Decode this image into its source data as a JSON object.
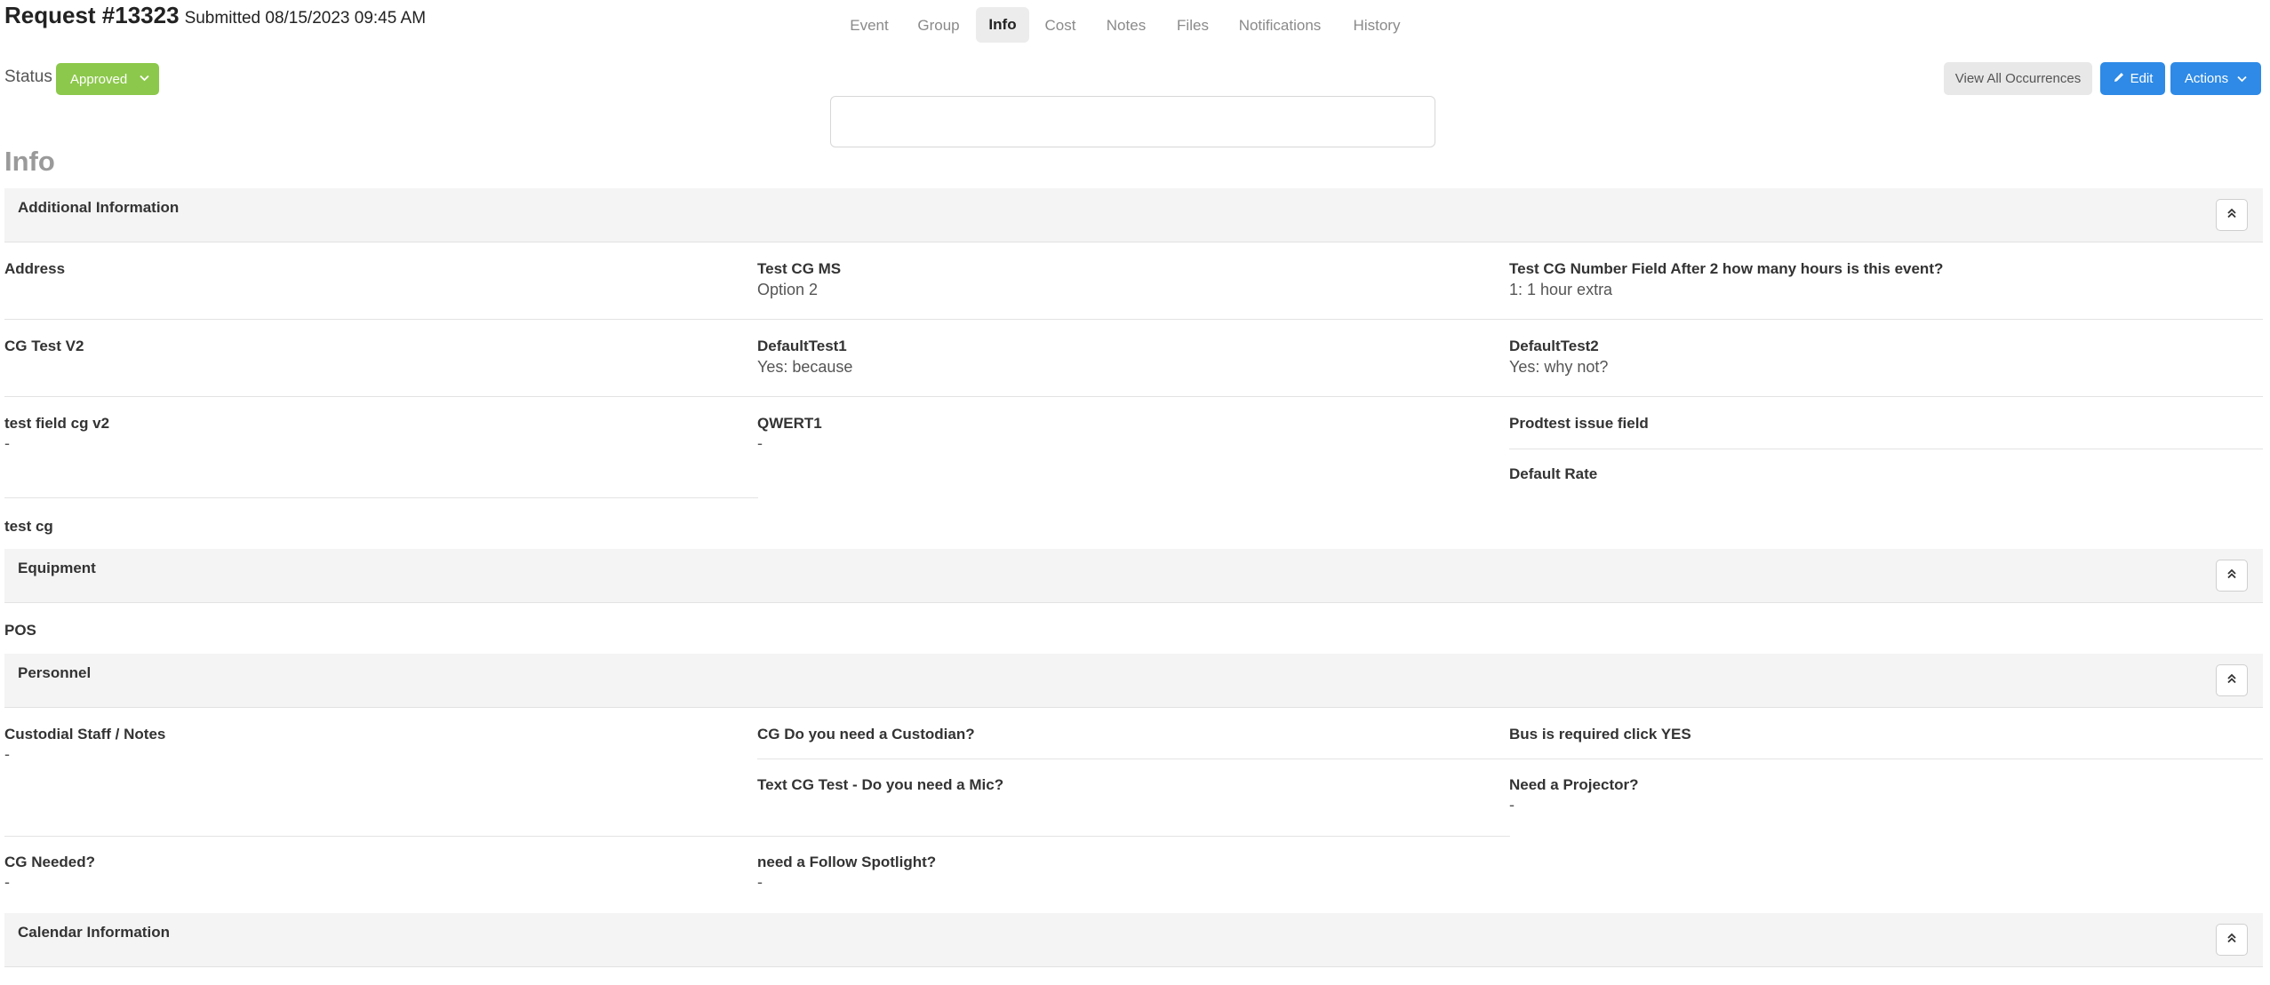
{
  "header": {
    "title": "Request #13323",
    "submitted": "Submitted 08/15/2023 09:45 AM"
  },
  "status": {
    "label": "Status",
    "value": "Approved",
    "color": "#8cc84b"
  },
  "actions": {
    "view_all": "View All Occurrences",
    "edit": "Edit",
    "actions": "Actions",
    "accent": "#2e8ae6"
  },
  "tabs": [
    {
      "label": "Event"
    },
    {
      "label": "Group"
    },
    {
      "label": "Info",
      "active": true
    },
    {
      "label": "Cost"
    },
    {
      "label": "Notes"
    },
    {
      "label": "Files"
    },
    {
      "label": "Notifications"
    },
    {
      "label": "History"
    }
  ],
  "page_heading": "Info",
  "sections": {
    "additional": {
      "title": "Additional Information",
      "fields": {
        "address": {
          "label": "Address",
          "value": ""
        },
        "test_cg_ms": {
          "label": "Test CG MS",
          "value": "Option 2"
        },
        "test_cg_number": {
          "label": "Test CG Number Field After 2 how many hours is this event?",
          "value": "1: 1 hour extra"
        },
        "cg_test_v2": {
          "label": "CG Test V2",
          "value": ""
        },
        "default_test1": {
          "label": "DefaultTest1",
          "value": "Yes: because"
        },
        "default_test2": {
          "label": "DefaultTest2",
          "value": "Yes: why not?"
        },
        "test_field_cg_v2": {
          "label": "test field cg v2",
          "value": "-"
        },
        "qwert1": {
          "label": "QWERT1",
          "value": "-"
        },
        "prodtest_issue": {
          "label": "Prodtest issue field",
          "value": ""
        },
        "default_rate": {
          "label": "Default Rate",
          "value": ""
        },
        "test_cg": {
          "label": "test cg",
          "value": ""
        }
      }
    },
    "equipment": {
      "title": "Equipment",
      "fields": {
        "pos": {
          "label": "POS",
          "value": ""
        }
      }
    },
    "personnel": {
      "title": "Personnel",
      "fields": {
        "custodial": {
          "label": "Custodial Staff / Notes",
          "value": "-"
        },
        "cg_custodian": {
          "label": "CG Do you need a Custodian?",
          "value": ""
        },
        "bus_required": {
          "label": "Bus is required click YES",
          "value": ""
        },
        "text_cg_mic": {
          "label": "Text CG Test - Do you need a Mic?",
          "value": ""
        },
        "projector": {
          "label": "Need a Projector?",
          "value": "-"
        },
        "cg_needed": {
          "label": "CG Needed?",
          "value": "-"
        },
        "spotlight": {
          "label": "need a Follow Spotlight?",
          "value": "-"
        }
      }
    },
    "calendar": {
      "title": "Calendar Information"
    }
  }
}
